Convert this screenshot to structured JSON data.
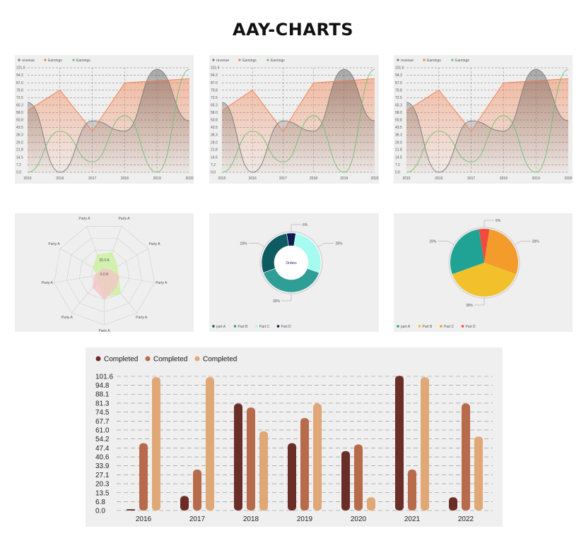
{
  "page": {
    "title": "AAY-CHARTS"
  },
  "colors": {
    "revenue": "#7a7a7a",
    "earnings_orange": "#f47c48",
    "earnings_green": "#6fbf73",
    "radar_green": "#c8f29a",
    "radar_pink": "#f6c2c8"
  },
  "chart_data": [
    {
      "type": "area",
      "legend": [
        "revenue",
        "Earnings",
        "Earnings"
      ],
      "x": [
        "2015",
        "2016",
        "2017",
        "2018",
        "2019",
        "2020"
      ],
      "ylim": [
        0,
        101.6
      ],
      "yticks": [
        "0.0",
        "7.2",
        "14.5",
        "21.8",
        "29.0",
        "36.3",
        "43.5",
        "50.8",
        "58.0",
        "65.3",
        "72.5",
        "79.8",
        "87.0",
        "94.3",
        "101.6"
      ],
      "series": [
        {
          "name": "revenue",
          "values": [
            68,
            0,
            50,
            40,
            100,
            50
          ]
        },
        {
          "name": "Earnings",
          "values": [
            60,
            80,
            40,
            87,
            89,
            91
          ]
        },
        {
          "name": "Earnings",
          "values": [
            0,
            40,
            10,
            55,
            0,
            100
          ]
        }
      ]
    },
    {
      "type": "area",
      "legend": [
        "revenue",
        "Earnings",
        "Earnings"
      ],
      "x": [
        "2015",
        "2016",
        "2017",
        "2018",
        "2019",
        "2020"
      ],
      "ylim": [
        0,
        101.6
      ],
      "yticks": [
        "0.0",
        "7.2",
        "14.5",
        "21.8",
        "29.0",
        "36.3",
        "43.5",
        "50.8",
        "58.0",
        "65.3",
        "72.5",
        "79.8",
        "87.0",
        "94.3",
        "101.6"
      ],
      "series": [
        {
          "name": "revenue",
          "values": [
            68,
            0,
            50,
            40,
            100,
            50
          ]
        },
        {
          "name": "Earnings",
          "values": [
            60,
            80,
            40,
            87,
            89,
            91
          ]
        },
        {
          "name": "Earnings",
          "values": [
            0,
            40,
            10,
            55,
            0,
            100
          ]
        }
      ]
    },
    {
      "type": "area",
      "legend": [
        "revenue",
        "Earnings",
        "Earnings"
      ],
      "x": [
        "2015",
        "2016",
        "2017",
        "2018",
        "2019",
        "2020"
      ],
      "ylim": [
        0,
        101.6
      ],
      "yticks": [
        "0.0",
        "7.2",
        "14.5",
        "21.8",
        "29.0",
        "36.3",
        "43.5",
        "50.8",
        "58.0",
        "65.3",
        "72.5",
        "79.8",
        "87.0",
        "94.3",
        "101.6"
      ],
      "series": [
        {
          "name": "revenue",
          "values": [
            68,
            0,
            50,
            40,
            100,
            50
          ]
        },
        {
          "name": "Earnings",
          "values": [
            60,
            80,
            40,
            87,
            89,
            91
          ]
        },
        {
          "name": "Earnings",
          "values": [
            0,
            40,
            10,
            55,
            0,
            100
          ]
        }
      ]
    },
    {
      "type": "radar",
      "axes": [
        "Party A",
        "Party A",
        "Party A",
        "Party A",
        "Party A",
        "Party A",
        "Party A",
        "Party A",
        "Party A"
      ],
      "rings": [
        "20.0 A",
        "0.0 A"
      ],
      "series": [
        {
          "values": [
            0.45,
            0.3,
            0.28,
            0.5,
            0.45,
            0.2,
            0.15,
            0.25,
            0.4
          ],
          "color": "#c8f29a"
        },
        {
          "values": [
            0.1,
            0.15,
            0.3,
            0.35,
            0.5,
            0.35,
            0.2,
            0.1,
            0.1
          ],
          "color": "#f6c2c8"
        }
      ]
    },
    {
      "type": "pie",
      "variant": "donut",
      "center_label": "Orders",
      "slices": [
        {
          "label": "part A",
          "value": 28,
          "color": "#0e5b61"
        },
        {
          "label": "Part B",
          "value": 39,
          "color": "#2e9e97"
        },
        {
          "label": "Part C",
          "value": 28,
          "color": "#a5fbef"
        },
        {
          "label": "Part D",
          "value": 5,
          "color": "#0c1a4e"
        }
      ],
      "labels": [
        "28%",
        "39%",
        "28%",
        "6%"
      ]
    },
    {
      "type": "pie",
      "slices": [
        {
          "label": "part A",
          "value": 28,
          "color": "#20a394"
        },
        {
          "label": "Part B",
          "value": 39,
          "color": "#f2c02b"
        },
        {
          "label": "Part C",
          "value": 28,
          "color": "#f39c2b"
        },
        {
          "label": "Part D",
          "value": 5,
          "color": "#ef4c3f"
        }
      ],
      "labels": [
        "28%",
        "39%",
        "28%",
        "6%"
      ]
    },
    {
      "type": "bar",
      "categories": [
        "2016",
        "2017",
        "2018",
        "2019",
        "2020",
        "2021",
        "2022"
      ],
      "ylim": [
        0,
        101.6
      ],
      "yticks": [
        "0.0",
        "6.8",
        "13.5",
        "20.3",
        "27.1",
        "33.9",
        "40.6",
        "47.4",
        "54.2",
        "61.0",
        "67.7",
        "74.5",
        "81.3",
        "88.1",
        "94.8",
        "101.6"
      ],
      "series": [
        {
          "name": "Completed",
          "color": "#6b2e26",
          "values": [
            1,
            11,
            81,
            51,
            45,
            102,
            10
          ]
        },
        {
          "name": "Completed",
          "color": "#b86b4b",
          "values": [
            51,
            31,
            78,
            70,
            50,
            31,
            81
          ]
        },
        {
          "name": "Completed",
          "color": "#e0a877",
          "values": [
            101,
            101,
            60,
            81,
            10,
            101,
            56
          ]
        }
      ]
    }
  ]
}
